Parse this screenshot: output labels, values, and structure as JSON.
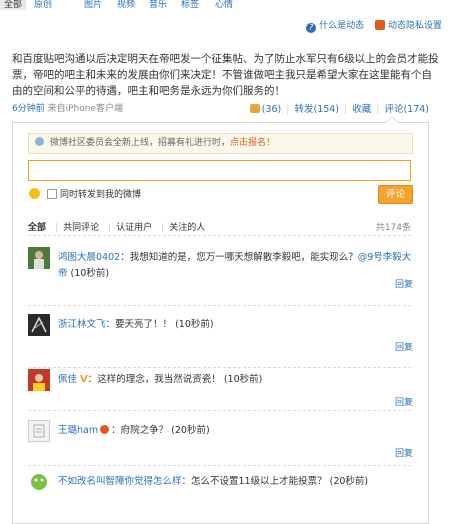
{
  "tabs": [
    "全部",
    "原创",
    "图片",
    "视频",
    "音乐",
    "标签",
    "心情"
  ],
  "help": {
    "what": "什么是动态",
    "privacy": "动态隐私设置"
  },
  "post": {
    "text": "和百度贴吧沟通以后决定明天在帝吧发一个征集帖、为了防止水军只有6级以上的会员才能投票，帝吧的吧主和未来的发展由你们来决定！不管谁做吧主我只是希望大家在这里能有个自由的空间和公平的待遇，吧主和吧务是永远为你们服务的！",
    "time": "6分钟前",
    "source": "来自iPhone客户端",
    "likes": "(36)",
    "forward": "转发(154)",
    "favorite": "收藏",
    "comment": "评论(174)"
  },
  "comment_box": {
    "notice_text": "微博社区委员会全新上线，招募有礼进行时，",
    "notice_link": "点击报名！",
    "also_forward": "同时转发到我的微博",
    "submit": "评论"
  },
  "filters": [
    "全部",
    "共同评论",
    "认证用户",
    "关注的人"
  ],
  "total": "共174条",
  "comments": [
    {
      "name": "鸿图大晨0402",
      "text": "：我想知道的是，您万一哪天想解散李毅吧，能实现么？",
      "mention": "@9号李毅大帝",
      "time": "(10秒前)",
      "reply": "回复"
    },
    {
      "name": "浙江林文飞",
      "text": "：要天亮了！！",
      "mention": "",
      "time": "(10秒前)",
      "reply": "回复"
    },
    {
      "name": "佩佳",
      "badge": "V",
      "text": "：这样的理念，我当然说资瓷！",
      "mention": "",
      "time": "(10秒前)",
      "reply": "回复"
    },
    {
      "name": "王璐ham",
      "text": "：府院之争？",
      "mention": "",
      "time": "(20秒前)",
      "reply": "回复"
    },
    {
      "name": "不如改名叫智障你觉得怎么样",
      "text": "：怎么不设置11级以上才能投票？",
      "mention": "",
      "time": "(20秒前)",
      "reply": "回复"
    }
  ]
}
